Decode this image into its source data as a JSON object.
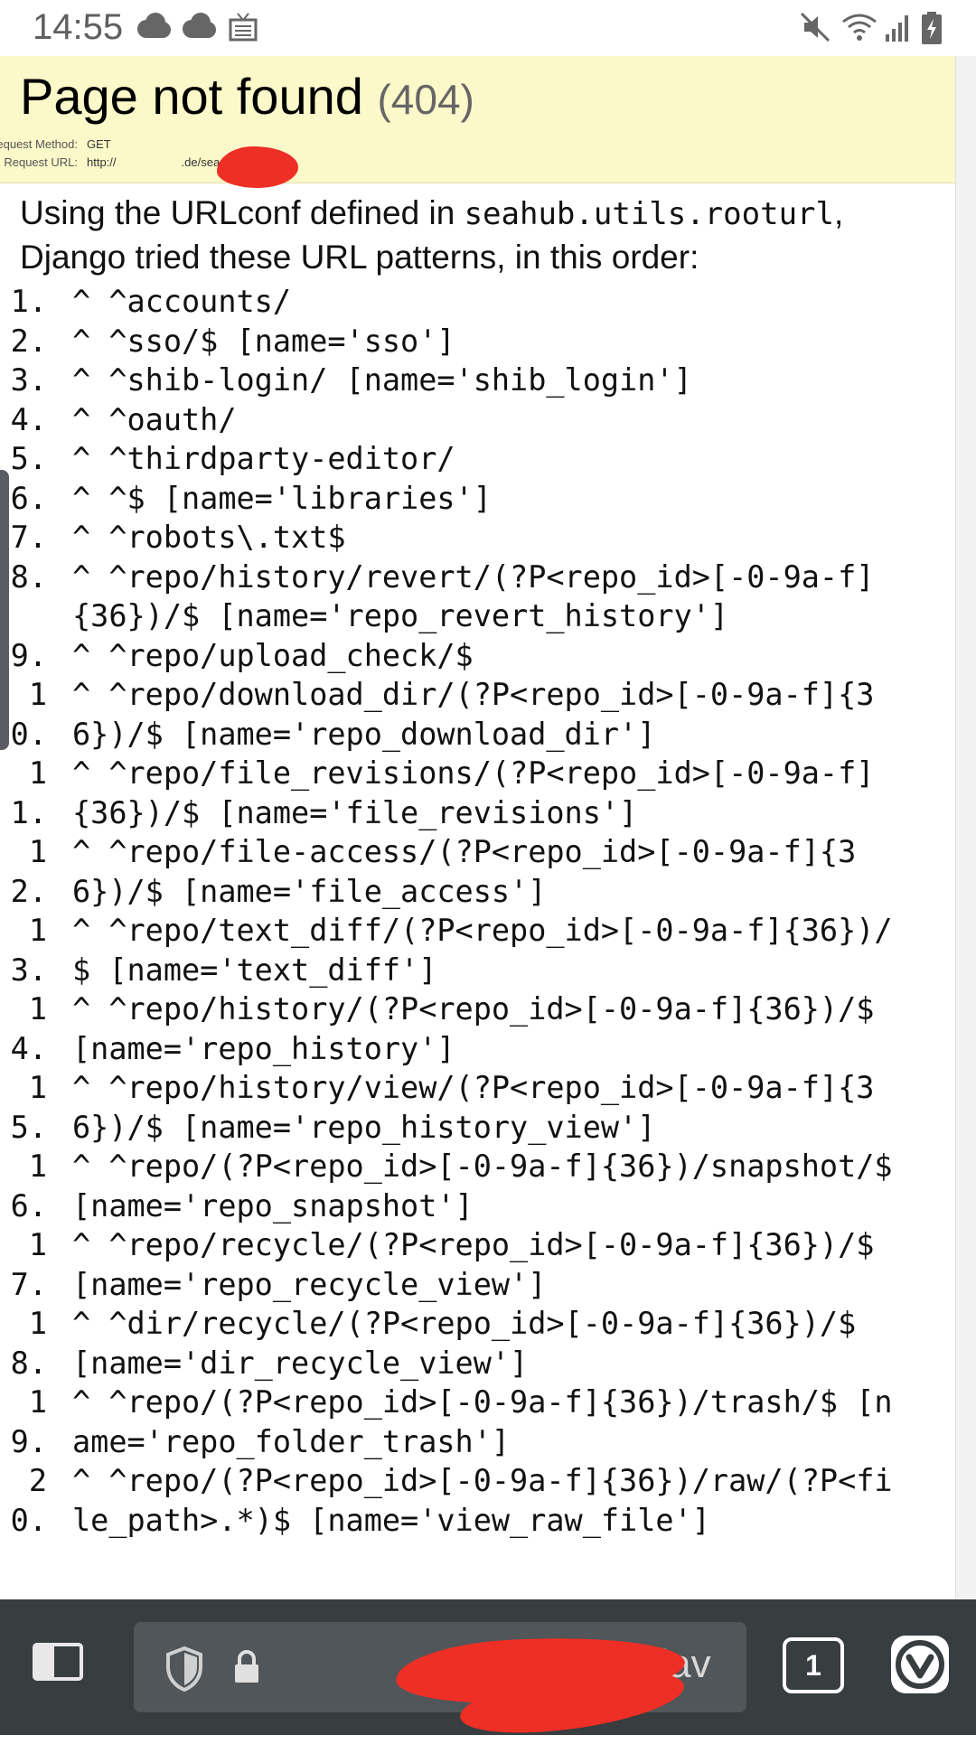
{
  "status_bar": {
    "time": "14:55",
    "icons": [
      "cloud-icon",
      "cloud-icon",
      "news-icon",
      "mute-icon",
      "wifi-icon",
      "signal-icon",
      "battery-charging-icon"
    ]
  },
  "summary": {
    "title": "Page not found",
    "code": "(404)",
    "request_method_label": "Request Method:",
    "request_method": "GET",
    "request_url_label": "Request URL:",
    "request_url_prefix": "http://",
    "request_url_suffix": ".de/seadav"
  },
  "info": {
    "line_prefix": "Using the URLconf defined in ",
    "urlconf": "seahub.utils.rooturl",
    "line_suffix": ",",
    "line2": "Django tried these URL patterns, in this order:"
  },
  "patterns": [
    {
      "num": "1.",
      "text": "^ ^accounts/"
    },
    {
      "num": "2.",
      "text": "^ ^sso/$ [name='sso']"
    },
    {
      "num": "3.",
      "text": "^ ^shib-login/ [name='shib_login']"
    },
    {
      "num": "4.",
      "text": "^ ^oauth/"
    },
    {
      "num": "5.",
      "text": "^ ^thirdparty-editor/"
    },
    {
      "num": "6.",
      "text": "^ ^$ [name='libraries']"
    },
    {
      "num": "7.",
      "text": "^ ^robots\\.txt$"
    },
    {
      "num": "8.",
      "text": "^ ^repo/history/revert/(?P<repo_id>[-0-9a-f]{36})/$ [name='repo_revert_history']"
    },
    {
      "num": "9.",
      "text": "^ ^repo/upload_check/$"
    },
    {
      "num": "10.",
      "text": "^ ^repo/download_dir/(?P<repo_id>[-0-9a-f]{36})/$ [name='repo_download_dir']"
    },
    {
      "num": "11.",
      "text": "^ ^repo/file_revisions/(?P<repo_id>[-0-9a-f]{36})/$ [name='file_revisions']"
    },
    {
      "num": "12.",
      "text": "^ ^repo/file-access/(?P<repo_id>[-0-9a-f]{36})/$ [name='file_access']"
    },
    {
      "num": "13.",
      "text": "^ ^repo/text_diff/(?P<repo_id>[-0-9a-f]{36})/$ [name='text_diff']"
    },
    {
      "num": "14.",
      "text": "^ ^repo/history/(?P<repo_id>[-0-9a-f]{36})/$ [name='repo_history']"
    },
    {
      "num": "15.",
      "text": "^ ^repo/history/view/(?P<repo_id>[-0-9a-f]{36})/$ [name='repo_history_view']"
    },
    {
      "num": "16.",
      "text": "^ ^repo/(?P<repo_id>[-0-9a-f]{36})/snapshot/$ [name='repo_snapshot']"
    },
    {
      "num": "17.",
      "text": "^ ^repo/recycle/(?P<repo_id>[-0-9a-f]{36})/$ [name='repo_recycle_view']"
    },
    {
      "num": "18.",
      "text": "^ ^dir/recycle/(?P<repo_id>[-0-9a-f]{36})/$ [name='dir_recycle_view']"
    },
    {
      "num": "19.",
      "text": "^ ^repo/(?P<repo_id>[-0-9a-f]{36})/trash/$ [name='repo_folder_trash']"
    },
    {
      "num": "20.",
      "text": "^ ^repo/(?P<repo_id>[-0-9a-f]{36})/raw/(?P<file_path>.*)$ [name='view_raw_file']"
    }
  ],
  "toolbar": {
    "url_visible": "e/seadav",
    "tab_count": "1"
  },
  "colors": {
    "summary_bg": "#fbf8c9",
    "toolbar_bg": "#383d40",
    "address_bg": "#50565a",
    "redaction": "#ee2f25"
  }
}
